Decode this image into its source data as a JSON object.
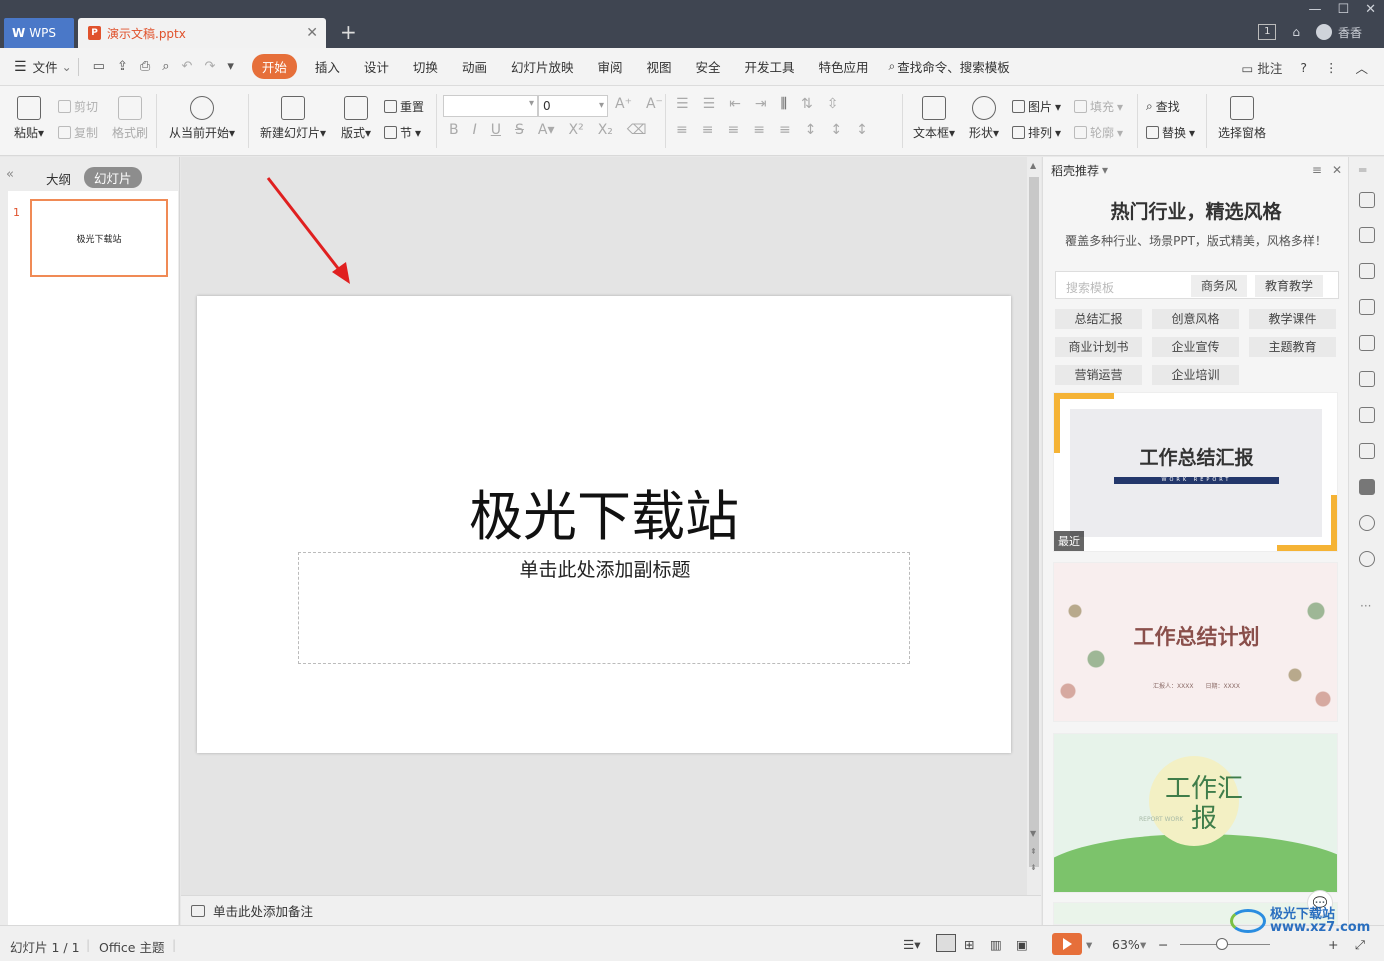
{
  "titlebar": {
    "app_tab": "WPS",
    "doc_tab": "演示文稿.pptx",
    "user_label": "香香",
    "badge": "1"
  },
  "menu": {
    "file": "文件",
    "items": [
      "开始",
      "插入",
      "设计",
      "切换",
      "动画",
      "幻灯片放映",
      "审阅",
      "视图",
      "安全",
      "开发工具",
      "特色应用"
    ],
    "active": "开始",
    "search": "查找命令、搜索模板",
    "comment": "批注"
  },
  "ribbon": {
    "paste": "粘贴",
    "cut": "剪切",
    "copy": "复制",
    "format_painter": "格式刷",
    "from_current": "从当前开始",
    "new_slide": "新建幻灯片",
    "layout": "版式",
    "reset": "重置",
    "section": "节",
    "font_size": "0",
    "textbox": "文本框",
    "shape": "形状",
    "picture": "图片",
    "fill": "填充",
    "arrange": "排列",
    "outline": "轮廓",
    "find": "查找",
    "replace": "替换",
    "select_pane": "选择窗格"
  },
  "left_panel": {
    "tab_outline": "大纲",
    "tab_slides": "幻灯片",
    "slide_number": "1",
    "thumb_text": "极光下载站"
  },
  "slide": {
    "title": "极光下载站",
    "subtitle_placeholder": "单击此处添加副标题"
  },
  "notes": {
    "placeholder": "单击此处添加备注"
  },
  "right_panel": {
    "header": "稻壳推荐",
    "title": "热门行业，精选风格",
    "subtitle": "覆盖多种行业、场景PPT，版式精美，风格多样！",
    "search_placeholder": "搜索模板",
    "chips": [
      "商务风",
      "教育教学"
    ],
    "tags": [
      "总结汇报",
      "创意风格",
      "教学课件",
      "商业计划书",
      "企业宣传",
      "主题教育",
      "营销运营",
      "企业培训"
    ],
    "templates": [
      {
        "title": "工作总结汇报",
        "sub": "WORK REPORT",
        "badge": "最近"
      },
      {
        "title": "工作总结计划",
        "sub": "汇报人：XXXX　　日期：XXXX"
      },
      {
        "title": "工作汇报",
        "sub": "REPORT WORK"
      }
    ]
  },
  "status": {
    "slide_info": "幻灯片 1 / 1",
    "theme": "Office 主题",
    "zoom": "63%"
  },
  "watermark": "极光下载站 www.xz7.com",
  "colors": {
    "accent": "#e66f3a",
    "titlebar": "#3f4551",
    "wps_tab": "#4a78c8",
    "arrow": "#e02020"
  }
}
